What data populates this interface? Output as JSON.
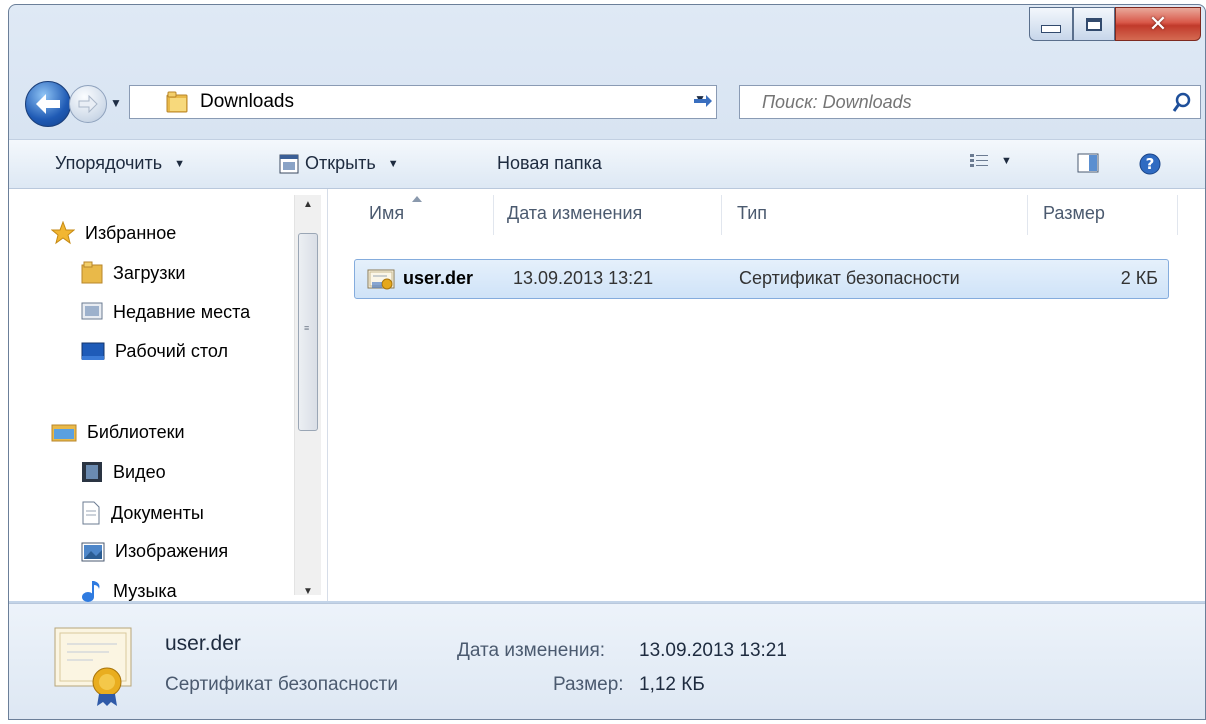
{
  "window": {
    "address": "Downloads",
    "search_placeholder": "Поиск: Downloads"
  },
  "toolbar": {
    "organize": "Упорядочить",
    "open": "Открыть",
    "new_folder": "Новая папка"
  },
  "nav": {
    "favorites": {
      "label": "Избранное",
      "items": [
        "Загрузки",
        "Недавние места",
        "Рабочий стол"
      ]
    },
    "libraries": {
      "label": "Библиотеки",
      "items": [
        "Видео",
        "Документы",
        "Изображения",
        "Музыка"
      ]
    }
  },
  "columns": [
    "Имя",
    "Дата изменения",
    "Тип",
    "Размер"
  ],
  "files": [
    {
      "name": "user.der",
      "modified": "13.09.2013 13:21",
      "type": "Сертификат безопасности",
      "size": "2 КБ"
    }
  ],
  "details": {
    "name": "user.der",
    "type": "Сертификат безопасности",
    "modified_label": "Дата изменения:",
    "modified_value": "13.09.2013 13:21",
    "size_label": "Размер:",
    "size_value": "1,12 КБ"
  }
}
